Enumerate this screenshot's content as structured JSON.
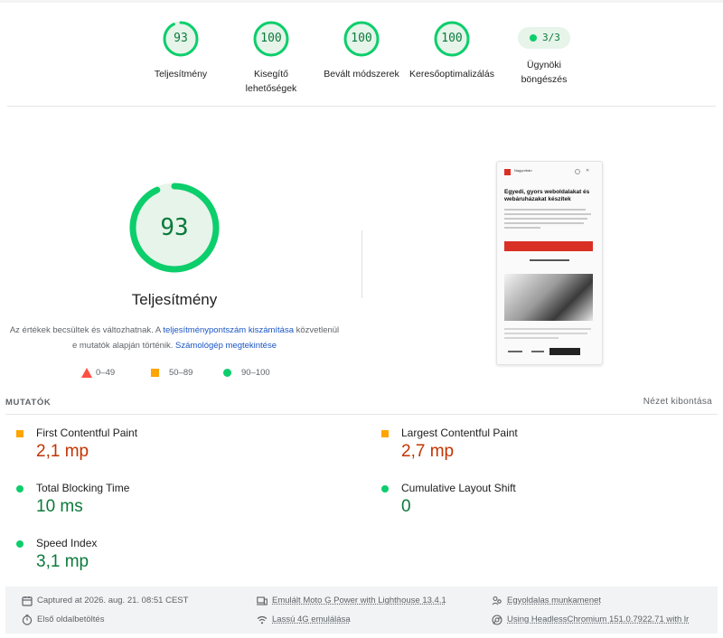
{
  "gauges": [
    {
      "score": "93",
      "label": "Teljesítmény",
      "fraction": 0.93
    },
    {
      "score": "100",
      "label": "Kisegítő lehetőségek",
      "fraction": 1.0
    },
    {
      "score": "100",
      "label": "Bevált módszerek",
      "fraction": 1.0
    },
    {
      "score": "100",
      "label": "Keresőoptimalizálás",
      "fraction": 1.0
    }
  ],
  "agentic": {
    "value": "3/3",
    "label": "Ügynöki böngészés"
  },
  "performance": {
    "score": "93",
    "fraction": 0.93,
    "title": "Teljesítmény",
    "desc_before": "Az értékek becsültek és változhatnak. A ",
    "desc_link1": "teljesítménypontszám kiszámítása",
    "desc_middle": " közvetlenül e mutatók alapján történik. ",
    "desc_link2": "Számológép megtekintése"
  },
  "legend": {
    "fail": "0–49",
    "average": "50–89",
    "pass": "90–100"
  },
  "screenshot": {
    "brand": "Nagyorbán",
    "headline": "Egyedi, gyors weboldalakat és webáruházakat készítek"
  },
  "metrics": {
    "section_title": "MUTATÓK",
    "expand_label": "Nézet kibontása",
    "items": [
      {
        "name": "First Contentful Paint",
        "value": "2,1 mp",
        "status": "average"
      },
      {
        "name": "Largest Contentful Paint",
        "value": "2,7 mp",
        "status": "average"
      },
      {
        "name": "Total Blocking Time",
        "value": "10 ms",
        "status": "pass"
      },
      {
        "name": "Cumulative Layout Shift",
        "value": "0",
        "status": "pass"
      },
      {
        "name": "Speed Index",
        "value": "3,1 mp",
        "status": "pass"
      }
    ]
  },
  "footer": {
    "captured": "Captured at 2026. aug. 21. 08:51 CEST",
    "page_load": "Első oldalbetöltés",
    "device": "Emulált Moto G Power with Lighthouse 13.4.1",
    "network": "Lassú 4G emulálása",
    "session": "Egyoldalas munkamenet",
    "browser": "Using HeadlessChromium 151.0.7922.71 with lr"
  },
  "colors": {
    "pass": "#0cce6b",
    "pass_text": "#0b7a3b",
    "average": "#ffa400",
    "fail": "#ff4e42",
    "metric_orange": "#c33300",
    "link": "#1a55c4"
  }
}
